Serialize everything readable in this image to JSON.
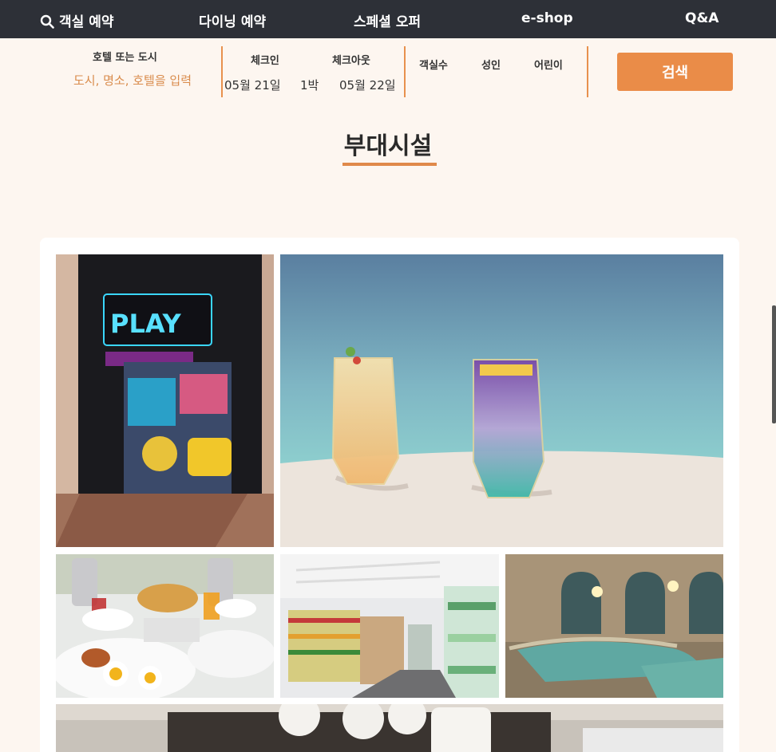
{
  "nav": {
    "rooms": "객실 예약",
    "dining": "다이닝 예약",
    "special": "스페셜 오퍼",
    "eshop": "e-shop",
    "qna": "Q&A",
    "icon": "search-icon"
  },
  "search": {
    "city_label": "호텔 또는 도시",
    "city_placeholder": "도시, 명소, 호텔을 입력",
    "checkin_label": "체크인",
    "checkout_label": "체크아웃",
    "checkin_date": "05월 21일",
    "nights": "1박",
    "checkout_date": "05월 22일",
    "rooms_label": "객실수",
    "adults_label": "성인",
    "children_label": "어린이",
    "button": "검색"
  },
  "section": {
    "title": "부대시설"
  },
  "gallery": [
    {
      "name": "play-zone-photo",
      "caption": ""
    },
    {
      "name": "cocktails-photo",
      "caption": ""
    },
    {
      "name": "breakfast-photo",
      "caption": ""
    },
    {
      "name": "convenience-store-photo",
      "caption": ""
    },
    {
      "name": "spa-pool-photo",
      "caption": ""
    },
    {
      "name": "cafe-photo",
      "caption": ""
    }
  ],
  "colors": {
    "nav_bg": "#2d3037",
    "accent": "#ea8c48",
    "page_bg": "#fdf6f0"
  }
}
